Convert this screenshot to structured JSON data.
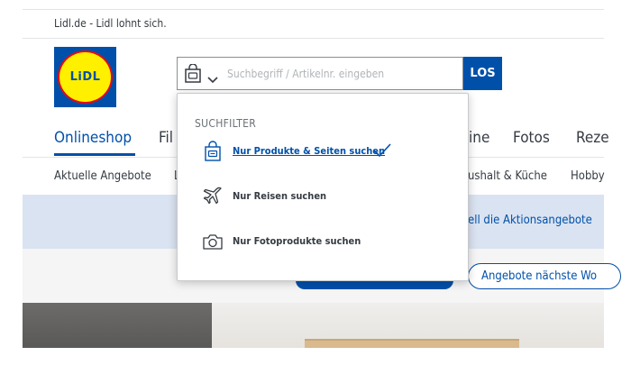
{
  "header": {
    "tagline": "Lidl.de - Lidl lohnt sich.",
    "logo_text": "LiDL"
  },
  "search": {
    "placeholder": "Suchbegriff / Artikelnr. eingeben",
    "value": "",
    "submit_label": "LOS"
  },
  "nav": {
    "items": [
      "Onlineshop",
      "Fil",
      "ine",
      "Fotos",
      "Reze"
    ]
  },
  "subnav": {
    "items": [
      "Aktuelle Angebote",
      "L",
      "ushalt & Küche",
      "Hobby"
    ]
  },
  "banner": {
    "text": "ell die Aktionsangebote"
  },
  "actions": {
    "next_week_label": "Angebote nächste Wo"
  },
  "dropdown": {
    "title": "SUCHFILTER",
    "options": [
      {
        "label": "Nur Produkte & Seiten suchen",
        "icon": "shopping-bag-icon",
        "selected": true
      },
      {
        "label": "Nur Reisen suchen",
        "icon": "airplane-icon",
        "selected": false
      },
      {
        "label": "Nur Fotoprodukte suchen",
        "icon": "camera-icon",
        "selected": false
      }
    ]
  },
  "colors": {
    "brand_blue": "#0050aa",
    "brand_yellow": "#fff000",
    "brand_red": "#e60a14",
    "banner_bg": "#dae3f1"
  }
}
